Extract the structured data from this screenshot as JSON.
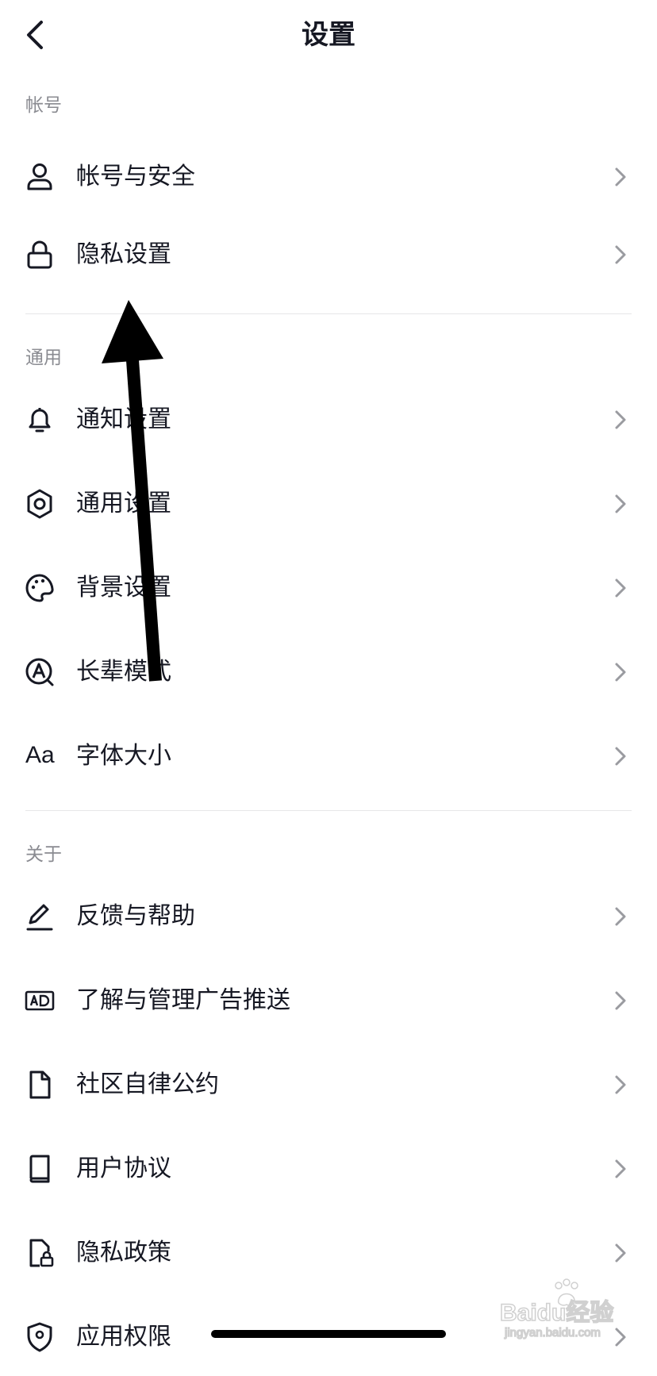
{
  "header": {
    "title": "设置"
  },
  "sections": {
    "account": {
      "label": "帐号",
      "items": [
        {
          "label": "帐号与安全",
          "icon": "person-icon"
        },
        {
          "label": "隐私设置",
          "icon": "lock-icon"
        }
      ]
    },
    "general": {
      "label": "通用",
      "items": [
        {
          "label": "通知设置",
          "icon": "bell-icon"
        },
        {
          "label": "通用设置",
          "icon": "gear-icon"
        },
        {
          "label": "背景设置",
          "icon": "palette-icon"
        },
        {
          "label": "长辈模式",
          "icon": "elder-mode-icon"
        },
        {
          "label": "字体大小",
          "icon": "font-size-icon",
          "icon_text": "Aa"
        }
      ]
    },
    "about": {
      "label": "关于",
      "items": [
        {
          "label": "反馈与帮助",
          "icon": "pencil-icon"
        },
        {
          "label": "了解与管理广告推送",
          "icon": "ad-icon"
        },
        {
          "label": "社区自律公约",
          "icon": "document-icon"
        },
        {
          "label": "用户协议",
          "icon": "book-icon"
        },
        {
          "label": "隐私政策",
          "icon": "document-lock-icon"
        },
        {
          "label": "应用权限",
          "icon": "shield-location-icon"
        }
      ]
    }
  },
  "watermark": {
    "brand": "Baidu经验",
    "url": "jingyan.baidu.com"
  },
  "colors": {
    "text": "#161823",
    "secondary": "#8a8b91",
    "divider": "#e6e6e8",
    "chevron": "#9a9ba0"
  }
}
